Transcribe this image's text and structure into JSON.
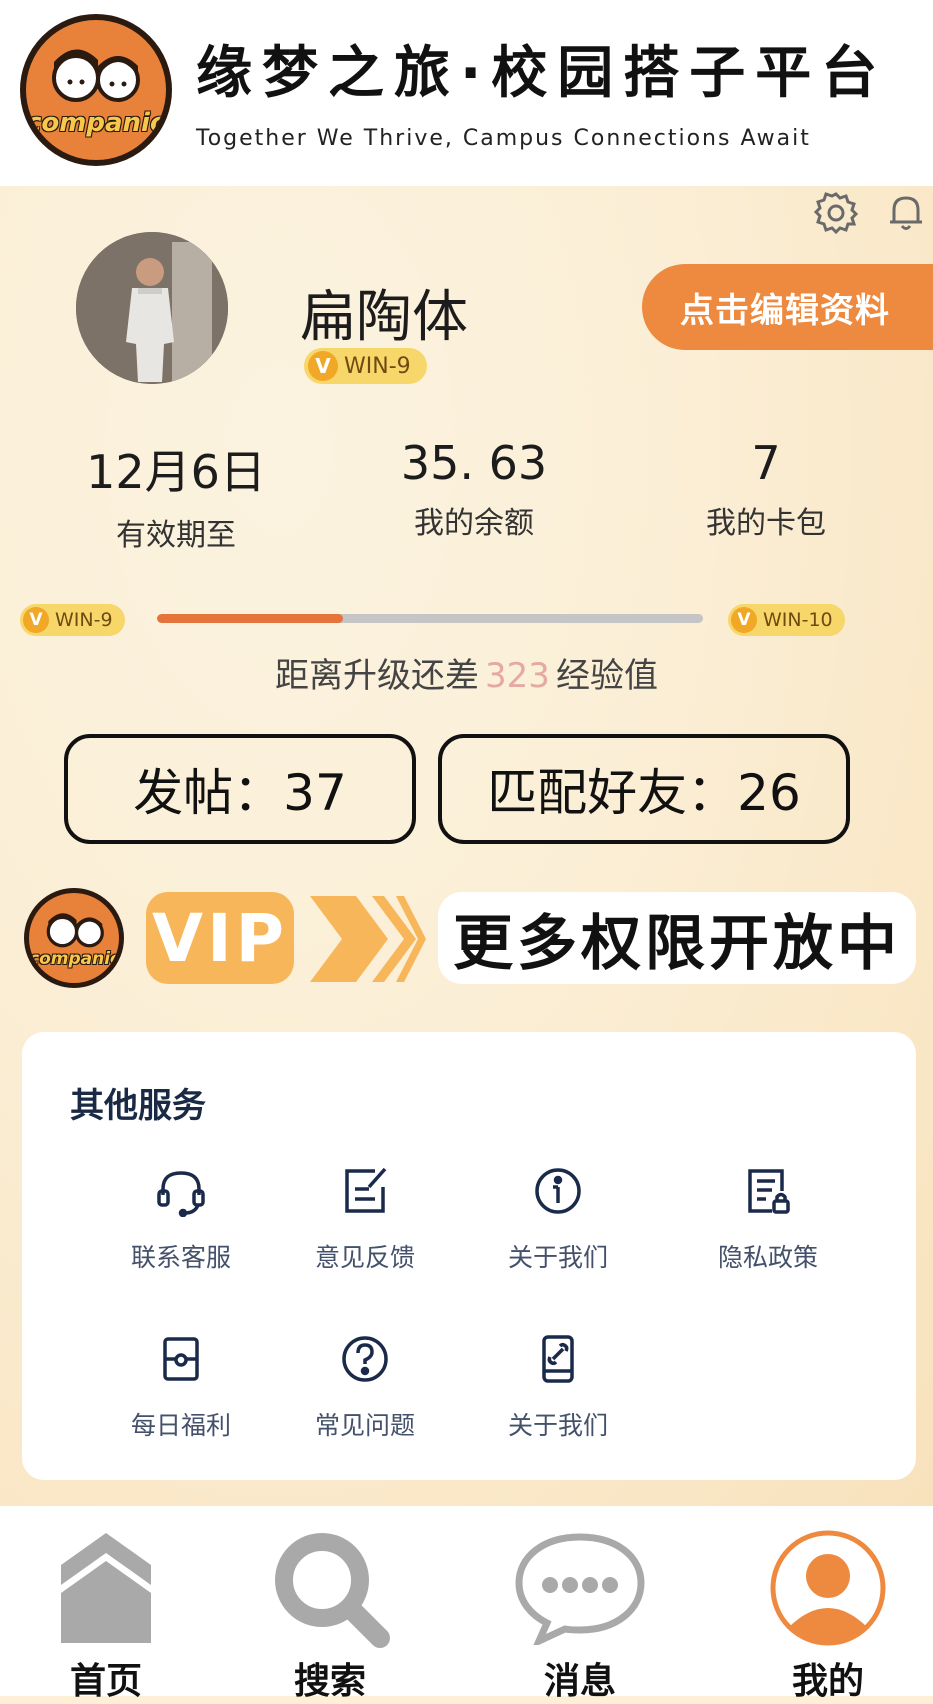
{
  "header": {
    "logo_text": "companion",
    "title": "缘梦之旅·校园搭子平台",
    "slogan": "Together We Thrive, Campus Connections Await"
  },
  "profile": {
    "username": "扁陶体",
    "level": "WIN-9",
    "edit_button": "点击编辑资料",
    "stats": [
      {
        "value": "12月6日",
        "label": "有效期至"
      },
      {
        "value": "35. 63",
        "label": "我的余额"
      },
      {
        "value": "7",
        "label": "我的卡包"
      }
    ],
    "progress": {
      "current_level": "WIN-9",
      "next_level": "WIN-10",
      "fill_fraction": 0.34,
      "prefix": "距离升级还差",
      "remaining": "323",
      "suffix": "经验值"
    },
    "posts": "发帖：37",
    "friends": "匹配好友：26"
  },
  "vip": {
    "logo_text": "companion",
    "label": "VIP",
    "message": "更多权限开放中"
  },
  "services": {
    "title": "其他服务",
    "items": [
      {
        "label": "联系客服",
        "icon": "headset-icon"
      },
      {
        "label": "意见反馈",
        "icon": "feedback-edit-icon"
      },
      {
        "label": "关于我们",
        "icon": "info-icon"
      },
      {
        "label": "隐私政策",
        "icon": "privacy-doc-lock-icon"
      },
      {
        "label": "每日福利",
        "icon": "daily-gift-icon"
      },
      {
        "label": "常见问题",
        "icon": "question-icon"
      },
      {
        "label": "关于我们",
        "icon": "phone-link-icon"
      }
    ]
  },
  "nav": {
    "items": [
      {
        "label": "首页",
        "icon": "home-chevron-icon",
        "active": false
      },
      {
        "label": "搜索",
        "icon": "search-icon",
        "active": false
      },
      {
        "label": "消息",
        "icon": "chat-bubble-icon",
        "active": false
      },
      {
        "label": "我的",
        "icon": "profile-person-icon",
        "active": true
      }
    ]
  },
  "colors": {
    "accent_orange": "#ee8a3f",
    "progress_fill": "#e5743a",
    "level_badge": "#f7d66a",
    "vip_pill": "#f8b65a",
    "nav_inactive": "#a9a9a9"
  }
}
